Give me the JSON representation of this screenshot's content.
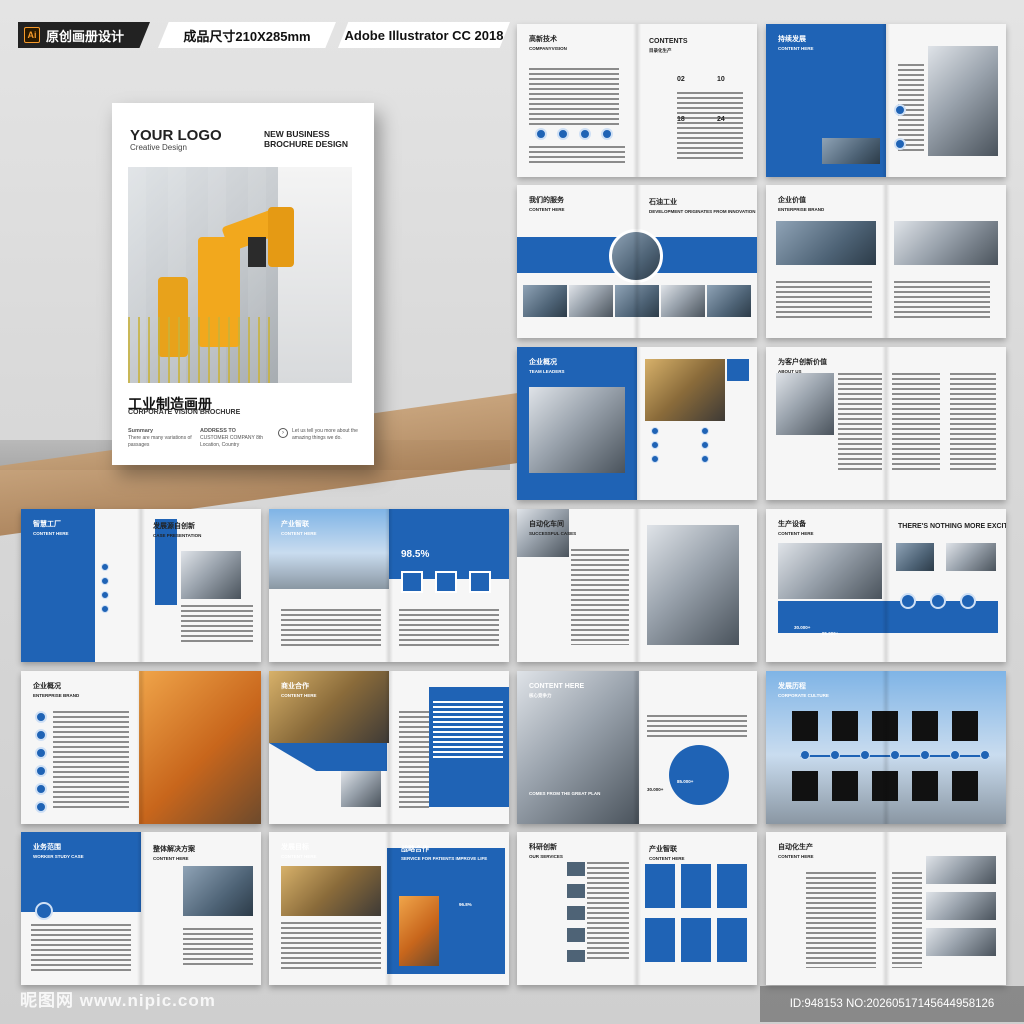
{
  "tags": {
    "ai_badge": "Ai",
    "design_label": "原创画册设计",
    "size_label": "成品尺寸210X285mm",
    "software_label": "Adobe Illustrator CC 2018"
  },
  "cover": {
    "logo": "YOUR LOGO",
    "logo_sub": "Creative Design",
    "headline": "NEW BUSINESS BROCHURE DESIGN",
    "title_cn": "工业制造画册",
    "title_en": "CORPORATE VISION BROCHURE",
    "summary_label": "Summary",
    "summary_text": "There are many variations of passages",
    "address_label": "ADDRESS TO",
    "address_text": "CUSTOMER COMPANY 8th Location, Country",
    "note_text": "Let us tell you more about the amazing things we do."
  },
  "spreads": [
    {
      "title": "高新技术",
      "sub": "COMPANYVISION",
      "title2": "CONTENTS",
      "sub2": "目录化生产",
      "nums": [
        "02",
        "10",
        "18",
        "24"
      ]
    },
    {
      "title": "持续发展",
      "sub": "CONTENT HERE"
    },
    {
      "title": "我们的服务",
      "sub": "CONTENT HERE",
      "title2": "石油工业",
      "sub2": "DEVELOPMENT ORIGINATES FROM INNOVATION"
    },
    {
      "title": "企业价值",
      "sub": "ENTERPRISE BRAND"
    },
    {
      "title": "企业概况",
      "sub": "TEAM LEADERS"
    },
    {
      "title": "为客户创新价值",
      "sub": "ABOUT US"
    },
    {
      "title": "智慧工厂",
      "sub": "CONTENT HERE",
      "title2": "发展源自创新",
      "sub2": "CASE PRESENTATION"
    },
    {
      "title": "产业智联",
      "sub": "CONTENT HERE",
      "stat": "98.5%"
    },
    {
      "title": "自动化车间",
      "sub": "SUCCESSFUL CASES"
    },
    {
      "title": "生产设备",
      "sub": "CONTENT HERE",
      "title2": "THERE'S NOTHING MORE EXCITING THAN A GOOD IDEA",
      "stat": "30.000+",
      "stat2": "85.000+"
    },
    {
      "title": "企业概况",
      "sub": "ENTERPRISE BRAND"
    },
    {
      "title": "商业合作",
      "sub": "CONTENT HERE"
    },
    {
      "title": "CONTENT HERE",
      "sub": "核心竞争力",
      "stat": "85.000+",
      "stat2": "30.000+",
      "overlay": "COMES FROM THE GREAT PLAN"
    },
    {
      "title": "发展历程",
      "sub": "CORPORATE CULTURE"
    },
    {
      "title": "业务范围",
      "sub": "WORKER  STUDY  CASE",
      "title2": "整体解决方案",
      "sub2": "CONTENT HERE"
    },
    {
      "title": "发展目标",
      "sub": "CONTENT HERE",
      "title2": "战略合作",
      "sub2": "SERVICE FOR PATIENTS IMPROVE LIFE",
      "stat": "96.8%"
    },
    {
      "title": "科研创新",
      "sub": "OUR SERVICES",
      "title2": "产业智联",
      "sub2": "CONTENT HERE"
    },
    {
      "title": "自动化生产",
      "sub": "CONTENT HERE"
    }
  ],
  "watermark": "昵图网 www.nipic.com",
  "image_id": "ID:948153 NO:20260517145644958126"
}
